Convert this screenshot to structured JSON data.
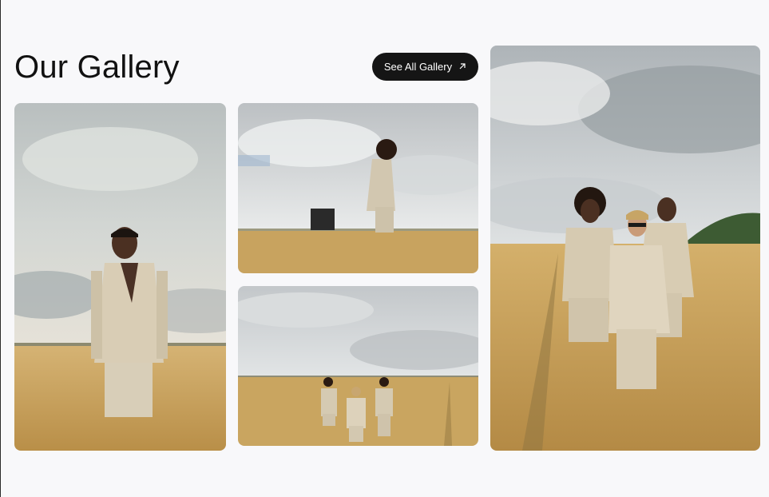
{
  "gallery": {
    "title": "Our Gallery",
    "see_all_label": "See All Gallery",
    "button_icon": "arrow-up-right-icon",
    "colors": {
      "button_bg": "#151515",
      "button_text": "#ffffff",
      "page_bg": "#f8f8fa",
      "sky": "#c9ced2",
      "wheat": "#c9a561",
      "suit": "#d6cbb6"
    }
  }
}
